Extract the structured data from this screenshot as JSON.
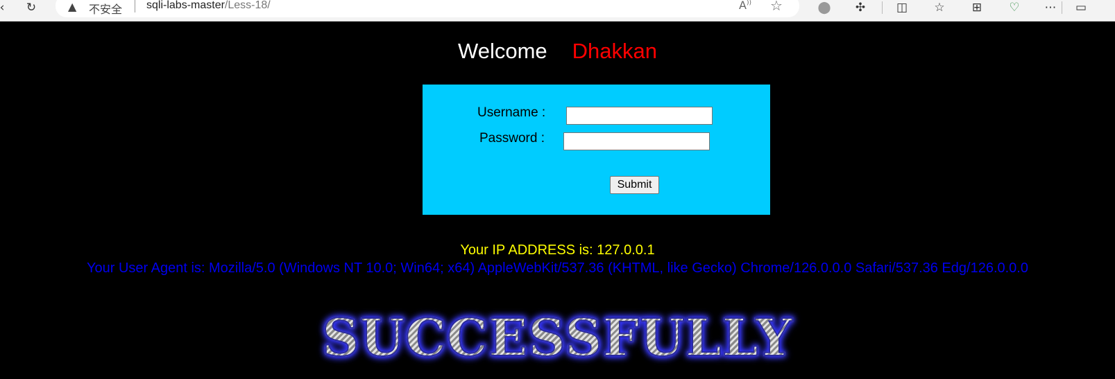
{
  "browser": {
    "security_label": "不安全",
    "url_host": "sqli-labs-master",
    "url_path": "/Less-18/",
    "icons": [
      "back-icon",
      "refresh-icon",
      "warning-icon",
      "read-aloud-icon",
      "favorite-star-icon",
      "circle-extension-icon",
      "extensions-puzzle-icon",
      "split-screen-icon",
      "favorites-icon",
      "collections-icon",
      "browser-essentials-icon",
      "more-icon",
      "sidebar-icon"
    ]
  },
  "page": {
    "welcome_text": "Welcome",
    "welcome_name": "Dhakkan",
    "form": {
      "username_label": "Username :",
      "password_label": "Password :",
      "username_value": "",
      "password_value": "",
      "submit_label": "Submit"
    },
    "ip_text": "Your IP ADDRESS is: 127.0.0.1",
    "user_agent_text": "Your User Agent is: Mozilla/5.0 (Windows NT 10.0; Win64; x64) AppleWebKit/537.36 (KHTML, like Gecko) Chrome/126.0.0.0 Safari/537.36 Edg/126.0.0.0",
    "banner_text": "SUCCESSFULLY"
  },
  "colors": {
    "page_background": "#000000",
    "form_background": "#00ccff",
    "welcome_name": "#ff0000",
    "ip_text": "#ffff00",
    "user_agent_text": "#0000ee"
  }
}
